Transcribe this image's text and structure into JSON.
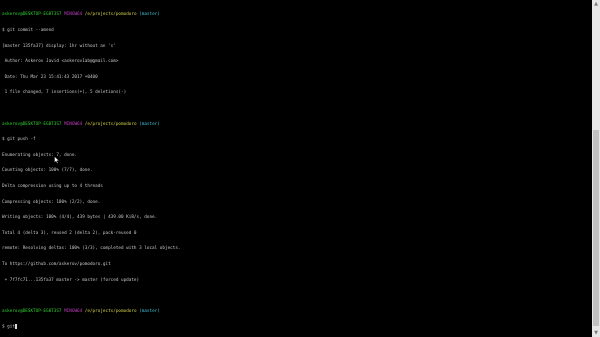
{
  "terminal": {
    "colors": {
      "background": "#000000",
      "text": "#c8c8c8",
      "user": "#2fd32f",
      "system": "#c23fc2",
      "path": "#d6d64a",
      "branch": "#3ec6d8"
    },
    "prompts": [
      {
        "user_host": "askerov@DESKTOP-EG8T3S7",
        "system": "MINGW64",
        "path": "/e/projects/pomodoro",
        "branch": "(master)"
      },
      {
        "user_host": "askerov@DESKTOP-EG8T3S7",
        "system": "MINGW64",
        "path": "/e/projects/pomodoro",
        "branch": "(master)"
      },
      {
        "user_host": "askerov@DESKTOP-EG8T3S7",
        "system": "MINGW64",
        "path": "/e/projects/pomodoro",
        "branch": "(master)"
      }
    ],
    "block1": [
      "$ git commit --amend",
      "[master 135fa37] display: 1hr without an 's'",
      " Author: Askerov Javid <askerov1ab@gmail.com>",
      " Date: Thu Mar 23 15:41:43 2017 +0400",
      " 1 file changed, 7 insertions(+), 5 deletions(-)"
    ],
    "block2": [
      "$ git push -f",
      "Enumerating objects: 7, done.",
      "Counting objects: 100% (7/7), done.",
      "Delta compression using up to 4 threads",
      "Compressing objects: 100% (2/2), done.",
      "Writing objects: 100% (4/4), 439 bytes | 439.00 KiB/s, done.",
      "Total 4 (delta 3), reused 2 (delta 2), pack-reused 0",
      "remote: Resolving deltas: 100% (3/3), completed with 3 local objects.",
      "To https://github.com/askerov/pomodoro.git",
      " + 7f7fc71...135fa37 master -> master (forced update)"
    ],
    "current_input": "$ git"
  },
  "scrollbar": {
    "up_icon": "▲",
    "down_icon": "▼"
  }
}
